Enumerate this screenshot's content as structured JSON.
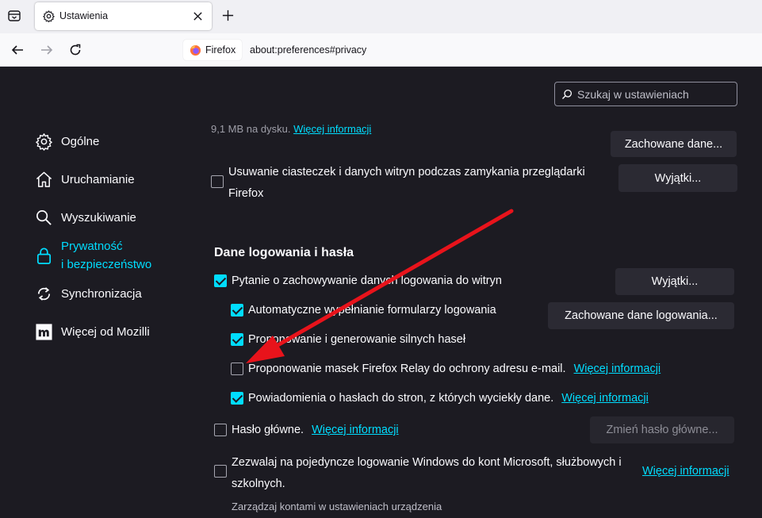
{
  "tab": {
    "title": "Ustawienia"
  },
  "urlbar": {
    "identity": "Firefox",
    "url": "about:preferences#privacy"
  },
  "search": {
    "placeholder": "Szukaj w ustawieniach"
  },
  "sidebar": {
    "items": [
      {
        "label": "Ogólne",
        "icon": "gear-icon"
      },
      {
        "label": "Uruchamianie",
        "icon": "home-icon"
      },
      {
        "label": "Wyszukiwanie",
        "icon": "search-icon"
      },
      {
        "label_line1": "Prywatność",
        "label_line2": "i bezpieczeństwo",
        "icon": "lock-icon",
        "active": true
      },
      {
        "label": "Synchronizacja",
        "icon": "sync-icon"
      },
      {
        "label": "Więcej od Mozilli",
        "icon": "mozilla-icon"
      }
    ]
  },
  "cookies": {
    "faded_text": "9,1 MB na dysku.",
    "faded_link": "Więcej informacji",
    "saved_data_button": "Zachowane dane...",
    "delete_on_close": "Usuwanie ciasteczek i danych witryn podczas zamykania przeglądarki Firefox",
    "delete_on_close_checked": false,
    "exceptions_button": "Wyjątki..."
  },
  "logins": {
    "title": "Dane logowania i hasła",
    "ask_to_save": {
      "label": "Pytanie o zachowywanie danych logowania do witryn",
      "checked": true
    },
    "exceptions_button": "Wyjątki...",
    "autofill": {
      "label": "Automatyczne wypełnianie formularzy logowania",
      "checked": true
    },
    "saved_logins_button": "Zachowane dane logowania...",
    "suggest_strong": {
      "label": "Proponowanie i generowanie silnych haseł",
      "checked": true
    },
    "relay_masks": {
      "label": "Proponowanie masek Firefox Relay do ochrony adresu e-mail.",
      "link": "Więcej informacji",
      "checked": false
    },
    "breach_alerts": {
      "label": "Powiadomienia o hasłach do stron, z których wyciekły dane.",
      "link": "Więcej informacji",
      "checked": true
    },
    "primary_password": {
      "label": "Hasło główne.",
      "link": "Więcej informacji",
      "checked": false
    },
    "change_password_button": "Zmień hasło główne...",
    "windows_sso": {
      "label": "Zezwalaj na pojedyncze logowanie Windows do kont Microsoft, służbowych i szkolnych.",
      "checked": false
    },
    "windows_sso_link": "Więcej informacji",
    "windows_sso_note": "Zarządzaj kontami w ustawieniach urządzenia"
  },
  "colors": {
    "accent": "#00ddff",
    "annotation_arrow": "#e8131b",
    "page_bg": "#1c1b22"
  }
}
